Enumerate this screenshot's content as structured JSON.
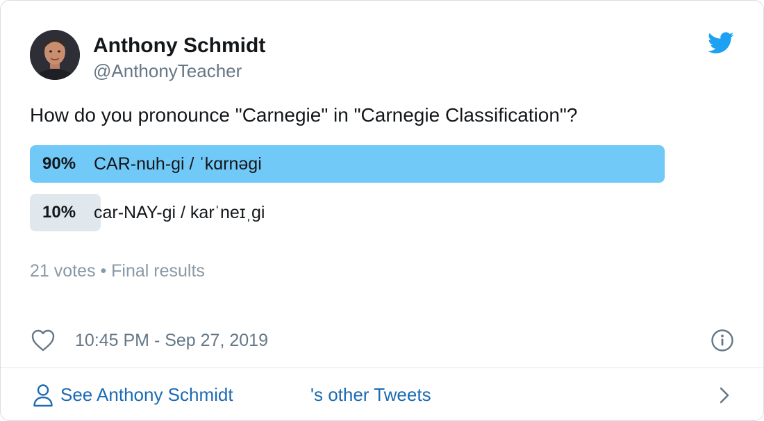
{
  "author": {
    "display_name": "Anthony Schmidt",
    "handle": "@AnthonyTeacher",
    "avatar_icon": "profile-photo"
  },
  "brand": {
    "logo_icon": "twitter-bird-icon",
    "accent_color": "#1da1f2"
  },
  "tweet": {
    "question": "How do you pronounce \"Carnegie\" in \"Carnegie Classification\"?"
  },
  "poll": {
    "options": [
      {
        "percent_label": "90%",
        "label": "CAR-nuh-gi / ˈkɑrnəgi",
        "percent": 90,
        "winner": true,
        "bar_color": "#71c9f8"
      },
      {
        "percent_label": "10%",
        "label": "car-NAY-gi / karˈneɪˌgi",
        "percent": 10,
        "winner": false,
        "bar_color": "#e1e8ed"
      }
    ],
    "footer": "21 votes • Final results"
  },
  "meta": {
    "timestamp": "10:45 PM - Sep 27, 2019",
    "like_icon": "heart-icon",
    "info_icon": "info-icon"
  },
  "footer": {
    "link_text_a": "See Anthony Schmidt",
    "link_text_b": "'s other Tweets",
    "link_color": "#1b6ab3"
  }
}
